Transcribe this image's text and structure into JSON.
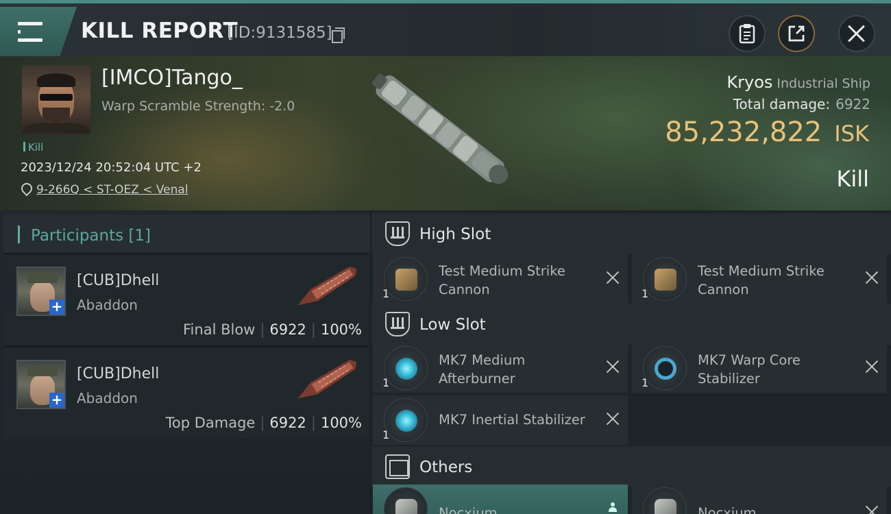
{
  "header": {
    "title": "KILL REPORT",
    "report_id": "[ID:9131585]",
    "icons": {
      "menu": "menu-icon",
      "copy": "copy-icon",
      "clipboard": "clipboard-icon",
      "share": "share-icon",
      "close": "close-icon"
    }
  },
  "victim": {
    "name": "[IMCO]Tango_",
    "warp_scramble": "Warp Scramble Strength: -2.0",
    "tag": "Kill",
    "datetime": "2023/12/24 20:52:04 UTC +2",
    "location": "9-266Q < ST-OEZ < Venal",
    "ship_name": "Kryos",
    "ship_class": "Industrial Ship",
    "total_damage_label": "Total damage:",
    "total_damage": "6922",
    "isk_value": "85,232,822",
    "isk_unit": "ISK",
    "result": "Kill"
  },
  "participants": {
    "title": "Participants [1]",
    "rows": [
      {
        "name": "[CUB]Dhell",
        "ship": "Abaddon",
        "role": "Final Blow",
        "damage": "6922",
        "percent": "100%"
      },
      {
        "name": "[CUB]Dhell",
        "ship": "Abaddon",
        "role": "Top Damage",
        "damage": "6922",
        "percent": "100%"
      }
    ]
  },
  "fitting": {
    "high_slot": {
      "title": "High Slot",
      "modules": [
        {
          "name": "Test Medium Strike Cannon",
          "qty": "1"
        },
        {
          "name": "Test Medium Strike Cannon",
          "qty": "1"
        }
      ]
    },
    "low_slot": {
      "title": "Low Slot",
      "modules": [
        {
          "name": "MK7 Medium Afterburner",
          "qty": "1"
        },
        {
          "name": "MK7 Warp Core Stabilizer",
          "qty": "1"
        },
        {
          "name": "MK7 Inertial Stabilizer",
          "qty": "1"
        }
      ]
    },
    "others": {
      "title": "Others",
      "modules": [
        {
          "name": "Nocxium"
        },
        {
          "name": "Nocxium"
        }
      ]
    }
  },
  "colors": {
    "accent": "#5fb0a4",
    "isk": "#e8c27a",
    "highlight": "#3e6f6a"
  }
}
